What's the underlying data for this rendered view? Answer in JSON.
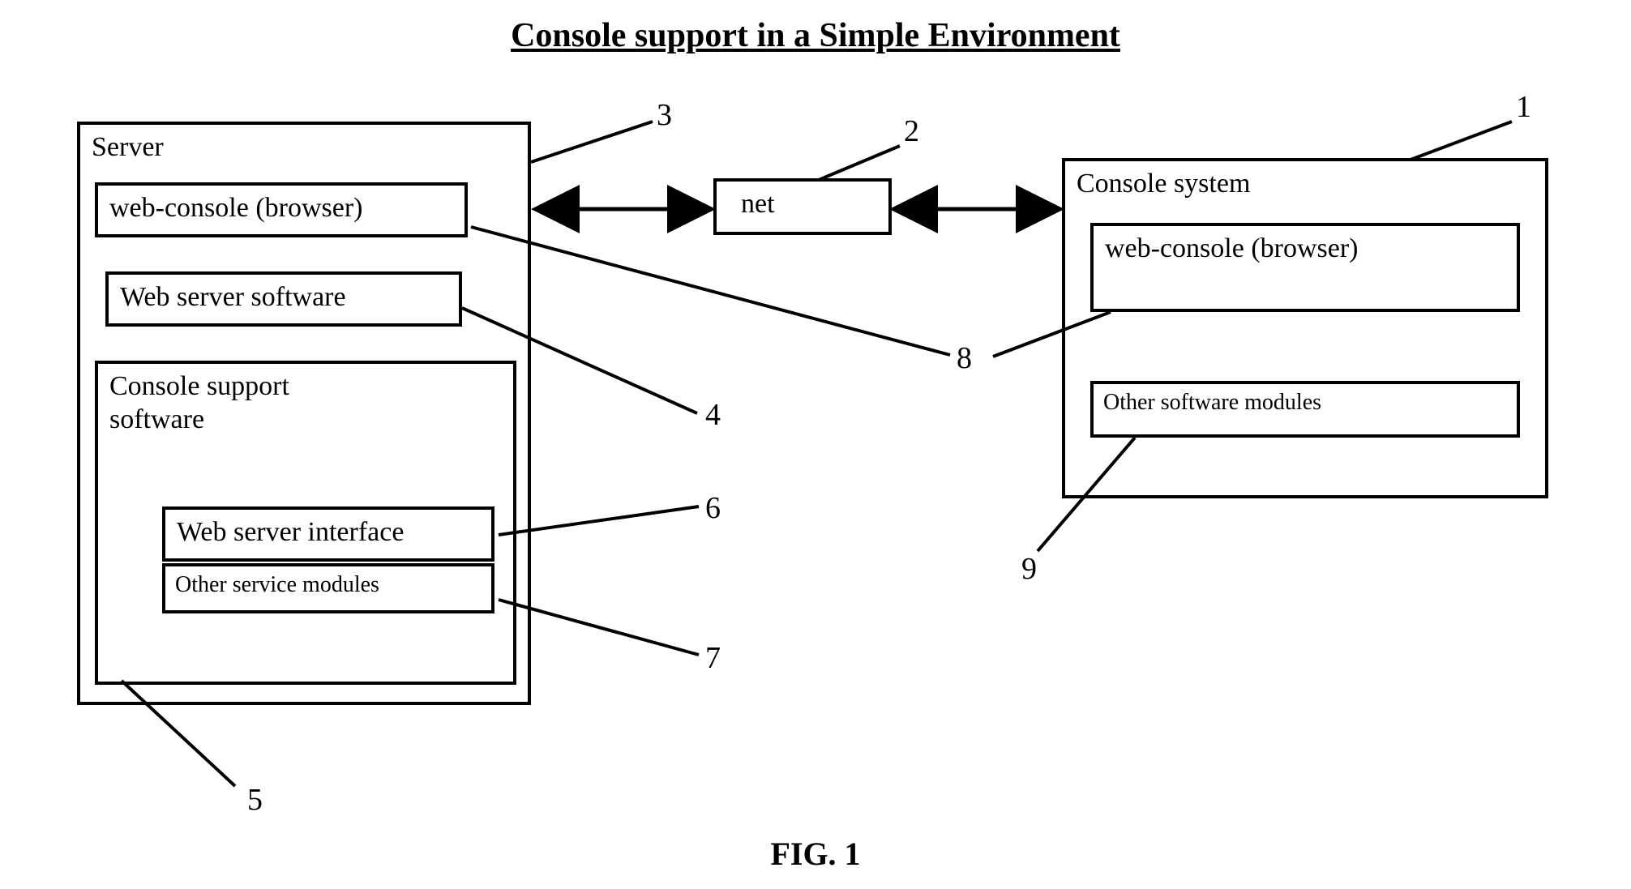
{
  "title": "Console support in a Simple Environment",
  "figure_caption": "FIG. 1",
  "server": {
    "title": "Server",
    "web_console": "web-console (browser)",
    "web_server_software": "Web server software",
    "console_support": {
      "title": "Console support software",
      "web_server_interface": "Web server interface",
      "other_service_modules": "Other service modules"
    }
  },
  "net": "net",
  "console_system": {
    "title": "Console system",
    "web_console": "web-console (browser)",
    "other_software_modules": "Other software modules"
  },
  "callouts": {
    "1": "1",
    "2": "2",
    "3": "3",
    "4": "4",
    "5": "5",
    "6": "6",
    "7": "7",
    "8": "8",
    "9": "9"
  }
}
